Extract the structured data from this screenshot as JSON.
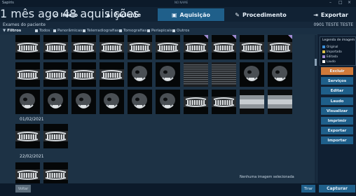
{
  "window": {
    "title": "Sapiris",
    "center_label": "NO NAME",
    "controls": [
      "–",
      "□",
      "×"
    ]
  },
  "nav": {
    "tabs": [
      {
        "label": "Início",
        "icon": "home-icon"
      },
      {
        "label": "Paciente",
        "icon": "user-icon"
      },
      {
        "label": "Aquisição",
        "icon": "camera-icon"
      },
      {
        "label": "Procedimento",
        "icon": "edit-icon"
      },
      {
        "label": "Exportar",
        "icon": "export-icon"
      }
    ],
    "active_tab": "Aquisição",
    "subtitle": "1 mês ago 48 aquisições"
  },
  "header": {
    "title": "Exames do paciente",
    "patient": "0901 TESTE TESTE"
  },
  "filters": {
    "label": "Filtros",
    "options": [
      "Todos",
      "Panorâmicas",
      "Telerradiografias",
      "Tomografias",
      "Periapicais",
      "Outros"
    ]
  },
  "gallery": {
    "rows": [
      [
        "pano",
        "pano",
        "pano",
        "pano",
        "pano",
        "pano",
        "pano",
        "pano",
        "pano",
        "pano"
      ],
      [
        "pano",
        "pano",
        "pano",
        "pano",
        "ceph",
        "ceph",
        "strip",
        "strip",
        "ceph",
        "ceph"
      ],
      [
        "ceph",
        "ceph",
        "ceph",
        "ceph",
        "ceph",
        "ceph",
        "pano",
        "pano",
        "bars",
        "bars"
      ]
    ],
    "flags_row1": [
      false,
      false,
      false,
      false,
      false,
      false,
      true,
      true,
      false,
      true
    ],
    "sections": [
      {
        "date": "01/02/2021",
        "items": [
          "pano",
          "pano"
        ]
      },
      {
        "date": "22/02/2021",
        "items": [
          "pano",
          "pano"
        ]
      }
    ]
  },
  "legend": {
    "title": "Legenda de imagem",
    "items": [
      {
        "label": "Original",
        "color": "#3c8fd8"
      },
      {
        "label": "Importada",
        "color": "#d9c04a"
      },
      {
        "label": "Editada",
        "color": "#a08bd3"
      },
      {
        "label": "Laudo",
        "color": "#ffffff"
      }
    ]
  },
  "actions": [
    "Excluir",
    "Serviços",
    "Editar",
    "Laudo",
    "Visualizar",
    "Imprimir",
    "Exportar",
    "Importar"
  ],
  "status": "Nenhuma imagem selecionada",
  "buttons": {
    "back": "Voltar",
    "take": "Tirar",
    "capture": "Capturar"
  }
}
